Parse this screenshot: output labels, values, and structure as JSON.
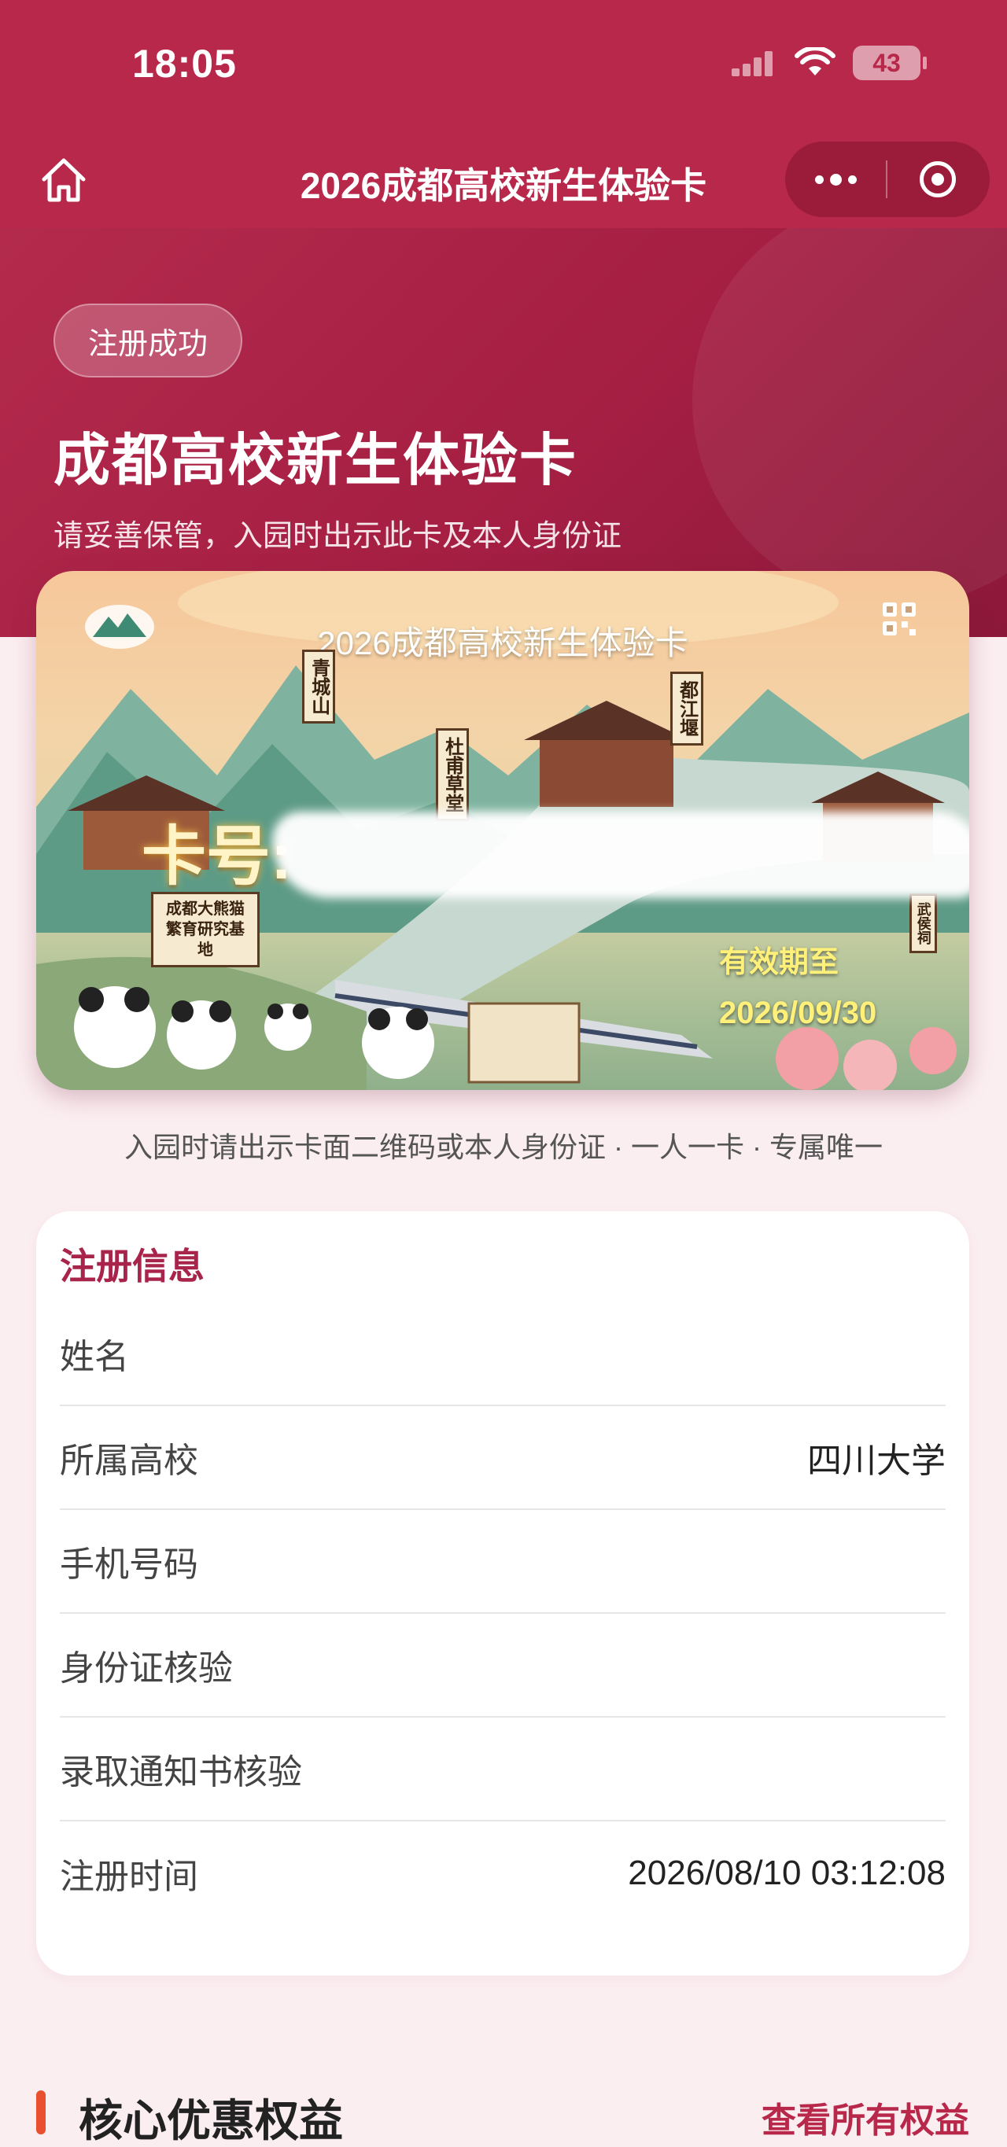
{
  "status_bar": {
    "time": "18:05",
    "battery": "43"
  },
  "nav": {
    "title": "2026成都高校新生体验卡"
  },
  "hero": {
    "badge": "注册成功",
    "title": "成都高校新生体验卡",
    "subtitle": "请妥善保管，入园时出示此卡及本人身份证"
  },
  "card": {
    "title": "2026成都高校新生体验卡",
    "number_label": "卡号:",
    "valid_label": "有效期至",
    "valid_date": "2026/09/30",
    "places": [
      "青城山",
      "都江堰",
      "杜甫草堂",
      "武侯祠"
    ],
    "panda_base": "成都大熊猫繁育研究基地"
  },
  "notice": "入园时请出示卡面二维码或本人身份证 · 一人一卡 · 专属唯一",
  "info": {
    "heading": "注册信息",
    "rows": [
      {
        "label": "姓名",
        "value": ""
      },
      {
        "label": "所属高校",
        "value": "四川大学"
      },
      {
        "label": "手机号码",
        "value": ""
      },
      {
        "label": "身份证核验",
        "value": ""
      },
      {
        "label": "录取通知书核验",
        "value": ""
      },
      {
        "label": "注册时间",
        "value": "2026/08/10 03:12:08"
      }
    ]
  },
  "benefits": {
    "title": "核心优惠权益",
    "link": "查看所有权益"
  },
  "colors": {
    "brand": "#b8284b",
    "accent": "#e8502f",
    "heading": "#a8244a"
  }
}
